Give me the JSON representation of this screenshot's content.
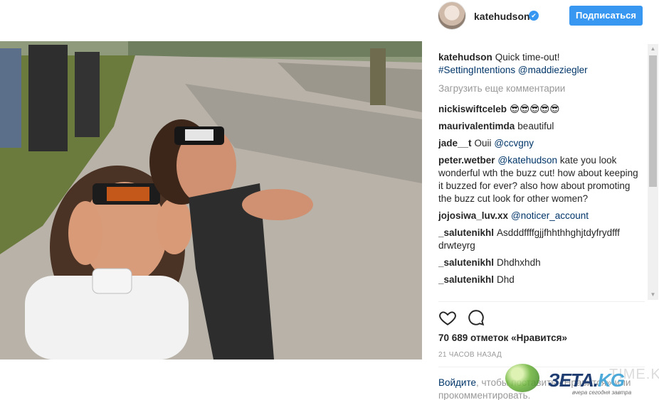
{
  "post": {
    "username": "katehudson",
    "verified_icon": "verified-badge-icon",
    "follow_label": "Подписаться",
    "caption_user": "katehudson",
    "caption_text": "Quick time-out!",
    "caption_tag": "#SettingIntentions",
    "caption_mention": "@maddieziegler",
    "load_more": "Загрузить еще комментарии",
    "likes": "70 689 отметок «Нравится»",
    "timestamp": "21 ЧАСОВ НАЗАД",
    "login_link": "Войдите",
    "login_rest": ", чтобы поставить «Нравится» или прокомментировать."
  },
  "comments": [
    {
      "user": "nickiswiftceleb",
      "text": "😎😎😎😎😎"
    },
    {
      "user": "maurivalentimda",
      "text": "beautiful"
    },
    {
      "user": "jade__t",
      "text": "Ouii",
      "mention": "@ccvgny"
    },
    {
      "user": "peter.wetber",
      "mention": "@katehudson",
      "text": "kate you look wonderful wth the buzz cut! how about keeping it buzzed for ever? also how about promoting the buzz cut look for other women?"
    },
    {
      "user": "jojosiwa_luv.xx",
      "mention": "@noticer_account",
      "text": ""
    },
    {
      "user": "_salutenikhl",
      "text": "Asdddffffgjjfhhthhghjtdyfrydfff drwteyrg"
    },
    {
      "user": "_salutenikhl",
      "text": "Dhdhxhdh"
    },
    {
      "user": "_salutenikhl",
      "text": "Dhd"
    }
  ],
  "watermark": {
    "brand": "ЗЕТА.",
    "brand_suffix": "KG",
    "slogan": "вчера сегодня завтра",
    "ghost": "TIME.KG"
  },
  "icons": {
    "like": "heart-icon",
    "comment": "speech-bubble-icon"
  },
  "colors": {
    "accent": "#3897f0",
    "link": "#003569",
    "muted": "#999999"
  }
}
